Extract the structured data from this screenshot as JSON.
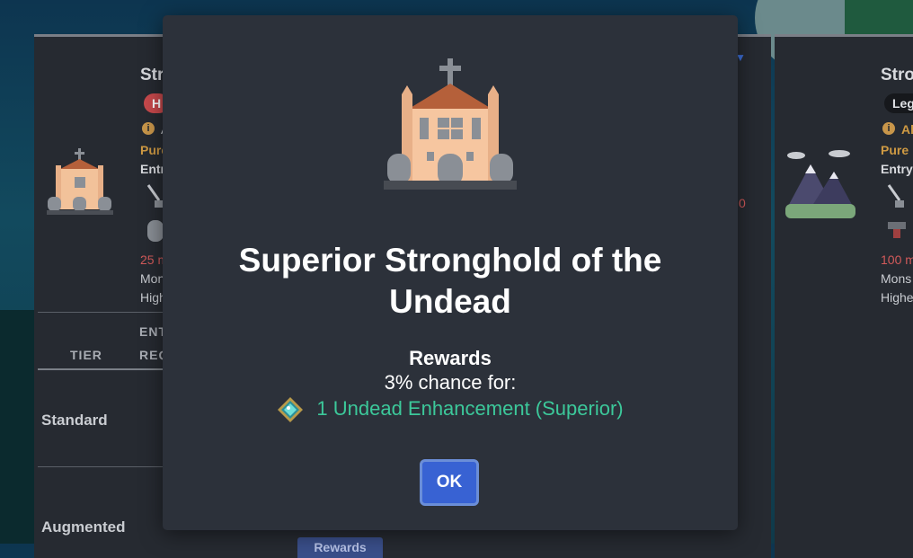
{
  "background": {
    "left_card": {
      "title": "Str",
      "badge": "H",
      "info_text": "A",
      "type_text": "Pure",
      "entry_text": "Entr",
      "min_text": "25 m",
      "monster_text": "Mon",
      "high_text": "High",
      "right_red": "0",
      "header_entry": "ENT",
      "header_tier": "TIER",
      "header_req": "REQ",
      "tiers": [
        "Standard",
        "Augmented"
      ],
      "rewards_button": "Rewards"
    },
    "right_card": {
      "title": "Stro",
      "badge": "Leg",
      "info_text": "Al",
      "type_text": "Pure",
      "entry_text": "Entry",
      "min_text": "100 m",
      "monster_text": "Mons",
      "high_text": "Highe"
    }
  },
  "modal": {
    "title": "Superior Stronghold of the Undead",
    "rewards_heading": "Rewards",
    "chance_text": "3% chance for:",
    "reward_item": "1 Undead Enhancement (Superior)",
    "ok_label": "OK",
    "icons": {
      "header": "haunted-church-icon",
      "reward": "enhancement-gem-icon"
    }
  },
  "colors": {
    "modal_bg": "#2c313a",
    "reward_text": "#3cc89a",
    "ok_button": "#3862d3"
  }
}
